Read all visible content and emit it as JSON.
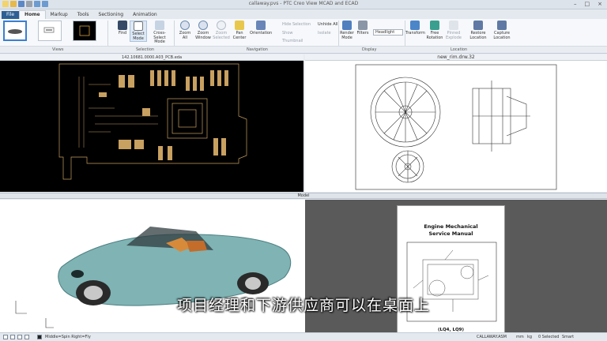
{
  "window": {
    "title": "callaway.pvs - PTC Creo View MCAD and ECAD"
  },
  "tabs": [
    "File",
    "Home",
    "Markup",
    "Tools",
    "Sectioning",
    "Animation"
  ],
  "ribbon": {
    "groups": [
      "Views",
      "Selection",
      "Navigation",
      "Display",
      "Location"
    ],
    "find": "Find",
    "select_mode": "Select Mode",
    "cross_select_mode": "Cross-Select Mode",
    "zoom_all": "Zoom All",
    "zoom_window": "Zoom Window",
    "zoom_selected": "Zoom Selected",
    "pan_center": "Pan Center",
    "orientation": "Orientation",
    "hide_selection": "Hide Selection",
    "show": "Show",
    "thumbnail": "Thumbnail",
    "unhide_all": "Unhide All",
    "isolate": "Isolate",
    "render_mode": "Render Mode",
    "filters": "Filters",
    "headlight": "Headlight",
    "transform": "Transform",
    "free_rotation": "Free Rotation",
    "pinned_explode": "Pinned Explode",
    "restore_location": "Restore Location",
    "capture_location": "Capture Location"
  },
  "panes": {
    "pcb_title": "142.10681.0000.A03_PCB.eda",
    "drawing_title": "new_rim.drw.32",
    "model_title": "Model",
    "manual_title_1": "Engine Mechanical",
    "manual_title_2": "Service Manual",
    "manual_caption": "(LQ4, LQ9)"
  },
  "subtitle": "项目经理和下游供应商可以在桌面上",
  "status": {
    "mode": "Middle=Spin  Right=Fly",
    "file": "CALLAWAY.ASM",
    "units": "mm",
    "mass": "kg",
    "selected": "0 Selected",
    "filter": "Smart"
  },
  "colors": {
    "ribbon_bg": "#f6f8fb",
    "pcb_bg": "#000000",
    "pcb_trace": "#c8a060",
    "car_body": "#7fb3b4",
    "model_bg": "#ffffff",
    "dark_pane": "#5a5a5a"
  }
}
